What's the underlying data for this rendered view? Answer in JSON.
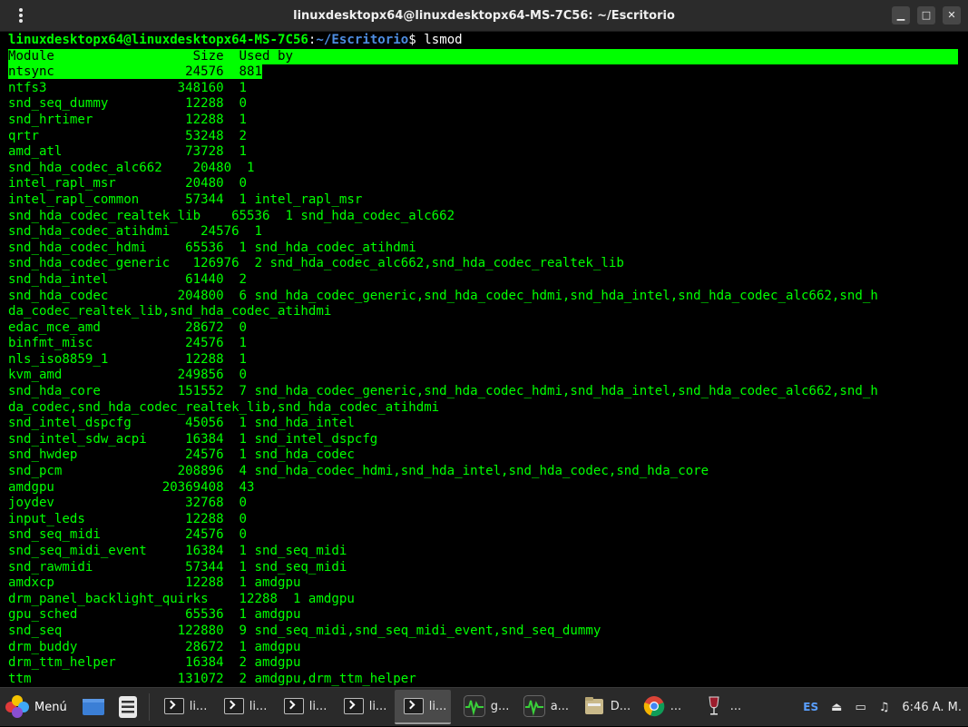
{
  "window": {
    "title": "linuxdesktopx64@linuxdesktopx64-MS-7C56: ~/Escritorio",
    "menu_icon": "kebab-menu-icon",
    "minimize_glyph": "▁",
    "maximize_glyph": "□",
    "close_glyph": "✕"
  },
  "terminal": {
    "prompt": {
      "user_host": "linuxdesktopx64@linuxdesktopx64-MS-7C56",
      "colon": ":",
      "path": "~/Escritorio",
      "dollar": "$ ",
      "command": "lsmod"
    },
    "header_line": "Module                  Size  Used by",
    "highlighted_line": "ntsync                 24576  881",
    "lines": [
      "ntfs3                 348160  1",
      "snd_seq_dummy          12288  0",
      "snd_hrtimer            12288  1",
      "qrtr                   53248  2",
      "amd_atl                73728  1",
      "snd_hda_codec_alc662    20480  1",
      "intel_rapl_msr         20480  0",
      "intel_rapl_common      57344  1 intel_rapl_msr",
      "snd_hda_codec_realtek_lib    65536  1 snd_hda_codec_alc662",
      "snd_hda_codec_atihdmi    24576  1",
      "snd_hda_codec_hdmi     65536  1 snd_hda_codec_atihdmi",
      "snd_hda_codec_generic   126976  2 snd_hda_codec_alc662,snd_hda_codec_realtek_lib",
      "snd_hda_intel          61440  2",
      "snd_hda_codec         204800  6 snd_hda_codec_generic,snd_hda_codec_hdmi,snd_hda_intel,snd_hda_codec_alc662,snd_h",
      "da_codec_realtek_lib,snd_hda_codec_atihdmi",
      "edac_mce_amd           28672  0",
      "binfmt_misc            24576  1",
      "nls_iso8859_1          12288  1",
      "kvm_amd               249856  0",
      "snd_hda_core          151552  7 snd_hda_codec_generic,snd_hda_codec_hdmi,snd_hda_intel,snd_hda_codec_alc662,snd_h",
      "da_codec,snd_hda_codec_realtek_lib,snd_hda_codec_atihdmi",
      "snd_intel_dspcfg       45056  1 snd_hda_intel",
      "snd_intel_sdw_acpi     16384  1 snd_intel_dspcfg",
      "snd_hwdep              24576  1 snd_hda_codec",
      "snd_pcm               208896  4 snd_hda_codec_hdmi,snd_hda_intel,snd_hda_codec,snd_hda_core",
      "amdgpu              20369408  43",
      "joydev                 32768  0",
      "input_leds             12288  0",
      "snd_seq_midi           24576  0",
      "snd_seq_midi_event     16384  1 snd_seq_midi",
      "snd_rawmidi            57344  1 snd_seq_midi",
      "amdxcp                 12288  1 amdgpu",
      "drm_panel_backlight_quirks    12288  1 amdgpu",
      "gpu_sched              65536  1 amdgpu",
      "snd_seq               122880  9 snd_seq_midi,snd_seq_midi_event,snd_seq_dummy",
      "drm_buddy              28672  1 amdgpu",
      "drm_ttm_helper         16384  2 amdgpu",
      "ttm                   131072  2 amdgpu,drm_ttm_helper"
    ]
  },
  "taskbar": {
    "menu_label": "Menú",
    "launchers": [
      {
        "name": "show-desktop-icon"
      },
      {
        "name": "files-icon"
      }
    ],
    "tasks": [
      {
        "label": "li...",
        "icon": "terminal-icon",
        "active": false
      },
      {
        "label": "li...",
        "icon": "terminal-icon",
        "active": false
      },
      {
        "label": "li...",
        "icon": "terminal-icon",
        "active": false
      },
      {
        "label": "li...",
        "icon": "terminal-icon",
        "active": false
      },
      {
        "label": "li...",
        "icon": "terminal-icon",
        "active": true
      },
      {
        "label": "g...",
        "icon": "system-monitor-icon",
        "active": false
      },
      {
        "label": "a...",
        "icon": "system-monitor-icon",
        "active": false
      },
      {
        "label": "D...",
        "icon": "file-manager-icon",
        "active": false
      },
      {
        "label": "...",
        "icon": "chrome-icon",
        "active": false
      },
      {
        "label": "...",
        "icon": "wine-icon",
        "active": false
      }
    ],
    "tray": {
      "language": "ES",
      "time": "6:46 A. M."
    }
  }
}
